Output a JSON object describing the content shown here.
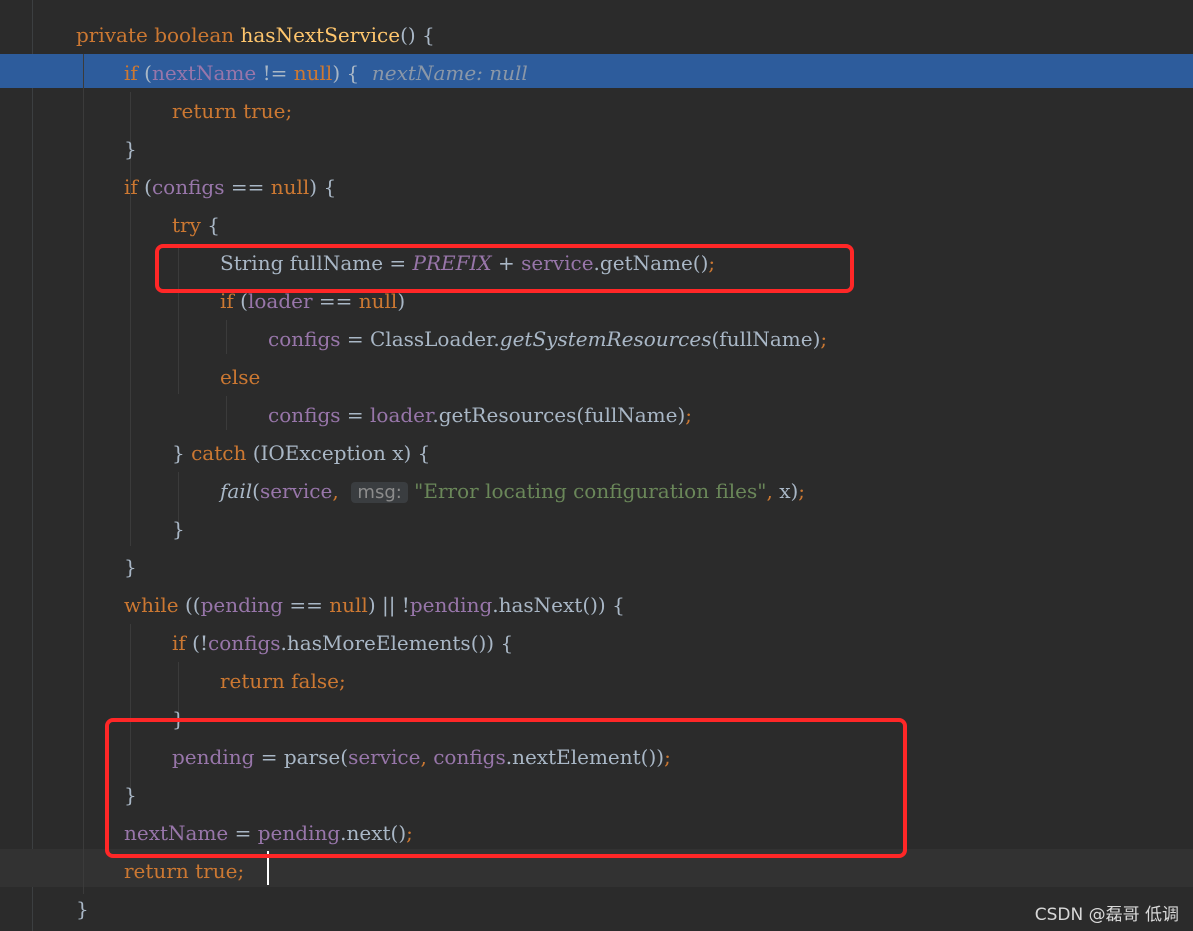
{
  "watermark": "CSDN @磊哥 低调",
  "lines": [
    {
      "indent": 0,
      "tokens": [
        {
          "c": "kw",
          "t": "private boolean "
        },
        {
          "c": "fn",
          "t": "hasNextService"
        },
        {
          "c": "p",
          "t": "() {"
        }
      ]
    },
    {
      "indent": 1,
      "tokens": [
        {
          "c": "kw",
          "t": "if "
        },
        {
          "c": "p",
          "t": "("
        },
        {
          "c": "var",
          "t": "nextName"
        },
        {
          "c": "p",
          "t": " != "
        },
        {
          "c": "kw",
          "t": "null"
        },
        {
          "c": "p",
          "t": ") {  "
        },
        {
          "c": "dbg",
          "t": "nextName: null"
        }
      ]
    },
    {
      "indent": 2,
      "tokens": [
        {
          "c": "kw",
          "t": "return true"
        },
        {
          "c": "kw",
          "t": ";"
        }
      ]
    },
    {
      "indent": 1,
      "tokens": [
        {
          "c": "p",
          "t": "}"
        }
      ]
    },
    {
      "indent": 1,
      "tokens": [
        {
          "c": "kw",
          "t": "if "
        },
        {
          "c": "p",
          "t": "("
        },
        {
          "c": "var",
          "t": "configs"
        },
        {
          "c": "p",
          "t": " == "
        },
        {
          "c": "kw",
          "t": "null"
        },
        {
          "c": "p",
          "t": ") {"
        }
      ]
    },
    {
      "indent": 2,
      "tokens": [
        {
          "c": "kw",
          "t": "try "
        },
        {
          "c": "p",
          "t": "{"
        }
      ]
    },
    {
      "indent": 3,
      "tokens": [
        {
          "c": "p",
          "t": "String fullName = "
        },
        {
          "c": "const",
          "t": "PREFIX"
        },
        {
          "c": "p",
          "t": " + "
        },
        {
          "c": "var",
          "t": "service"
        },
        {
          "c": "p",
          "t": ".getName()"
        },
        {
          "c": "kw",
          "t": ";"
        }
      ]
    },
    {
      "indent": 3,
      "tokens": [
        {
          "c": "kw",
          "t": "if "
        },
        {
          "c": "p",
          "t": "("
        },
        {
          "c": "var",
          "t": "loader"
        },
        {
          "c": "p",
          "t": " == "
        },
        {
          "c": "kw",
          "t": "null"
        },
        {
          "c": "p",
          "t": ")"
        }
      ]
    },
    {
      "indent": 4,
      "tokens": [
        {
          "c": "var",
          "t": "configs"
        },
        {
          "c": "p",
          "t": " = ClassLoader."
        },
        {
          "c": "st",
          "t": "getSystemResources"
        },
        {
          "c": "p",
          "t": "(fullName)"
        },
        {
          "c": "kw",
          "t": ";"
        }
      ]
    },
    {
      "indent": 3,
      "tokens": [
        {
          "c": "kw",
          "t": "else"
        }
      ]
    },
    {
      "indent": 4,
      "tokens": [
        {
          "c": "var",
          "t": "configs"
        },
        {
          "c": "p",
          "t": " = "
        },
        {
          "c": "var",
          "t": "loader"
        },
        {
          "c": "p",
          "t": ".getResources(fullName)"
        },
        {
          "c": "kw",
          "t": ";"
        }
      ]
    },
    {
      "indent": 2,
      "tokens": [
        {
          "c": "p",
          "t": "} "
        },
        {
          "c": "kw",
          "t": "catch "
        },
        {
          "c": "p",
          "t": "(IOException x) {"
        }
      ]
    },
    {
      "indent": 3,
      "tokens": [
        {
          "c": "st",
          "t": "fail"
        },
        {
          "c": "p",
          "t": "("
        },
        {
          "c": "var",
          "t": "service"
        },
        {
          "c": "kw",
          "t": ",  "
        },
        {
          "c": "hint",
          "t": "msg:"
        },
        {
          "c": "str",
          "t": " \"Error locating configuration files\""
        },
        {
          "c": "kw",
          "t": ", "
        },
        {
          "c": "p",
          "t": "x)"
        },
        {
          "c": "kw",
          "t": ";"
        }
      ]
    },
    {
      "indent": 2,
      "tokens": [
        {
          "c": "p",
          "t": "}"
        }
      ]
    },
    {
      "indent": 1,
      "tokens": [
        {
          "c": "p",
          "t": "}"
        }
      ]
    },
    {
      "indent": 1,
      "tokens": [
        {
          "c": "kw",
          "t": "while "
        },
        {
          "c": "p",
          "t": "(("
        },
        {
          "c": "var",
          "t": "pending"
        },
        {
          "c": "p",
          "t": " == "
        },
        {
          "c": "kw",
          "t": "null"
        },
        {
          "c": "p",
          "t": ") || !"
        },
        {
          "c": "var",
          "t": "pending"
        },
        {
          "c": "p",
          "t": ".hasNext()) {"
        }
      ]
    },
    {
      "indent": 2,
      "tokens": [
        {
          "c": "kw",
          "t": "if "
        },
        {
          "c": "p",
          "t": "(!"
        },
        {
          "c": "var",
          "t": "configs"
        },
        {
          "c": "p",
          "t": ".hasMoreElements()) {"
        }
      ]
    },
    {
      "indent": 3,
      "tokens": [
        {
          "c": "kw",
          "t": "return false"
        },
        {
          "c": "kw",
          "t": ";"
        }
      ]
    },
    {
      "indent": 2,
      "tokens": [
        {
          "c": "p",
          "t": "}"
        }
      ]
    },
    {
      "indent": 2,
      "tokens": [
        {
          "c": "var",
          "t": "pending"
        },
        {
          "c": "p",
          "t": " = parse("
        },
        {
          "c": "var",
          "t": "service"
        },
        {
          "c": "kw",
          "t": ", "
        },
        {
          "c": "var",
          "t": "configs"
        },
        {
          "c": "p",
          "t": ".nextElement())"
        },
        {
          "c": "kw",
          "t": ";"
        }
      ]
    },
    {
      "indent": 1,
      "tokens": [
        {
          "c": "p",
          "t": "}"
        }
      ]
    },
    {
      "indent": 1,
      "tokens": [
        {
          "c": "var",
          "t": "nextName"
        },
        {
          "c": "p",
          "t": " = "
        },
        {
          "c": "var",
          "t": "pending"
        },
        {
          "c": "p",
          "t": ".next()"
        },
        {
          "c": "kw",
          "t": ";"
        }
      ]
    },
    {
      "indent": 1,
      "tokens": [
        {
          "c": "kw",
          "t": "return true"
        },
        {
          "c": "kw",
          "t": ";"
        }
      ]
    },
    {
      "indent": 0,
      "tokens": [
        {
          "c": "p",
          "t": "}"
        }
      ]
    }
  ]
}
